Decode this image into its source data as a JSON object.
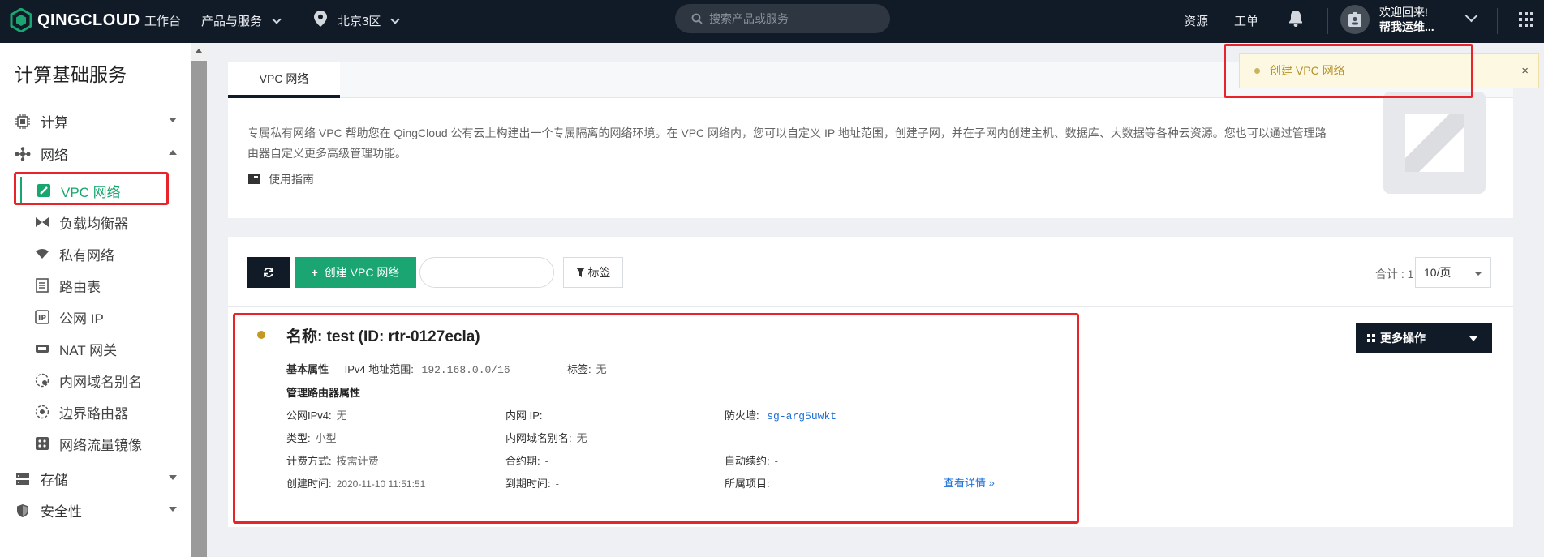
{
  "topbar": {
    "brand": "QINGCLOUD",
    "nav": {
      "workbench": "工作台",
      "products": "产品与服务",
      "region": "北京3区"
    },
    "search_placeholder": "搜索产品或服务",
    "resources": "资源",
    "tickets": "工单",
    "welcome": "欢迎回来!",
    "user": "帮我运维..."
  },
  "sidebar": {
    "title": "计算基础服务",
    "groups": {
      "compute": "计算",
      "network": "网络",
      "storage": "存储",
      "security": "安全性"
    },
    "items": [
      {
        "label": "VPC 网络"
      },
      {
        "label": "负载均衡器"
      },
      {
        "label": "私有网络"
      },
      {
        "label": "路由表"
      },
      {
        "label": "公网 IP"
      },
      {
        "label": "NAT 网关"
      },
      {
        "label": "内网域名别名"
      },
      {
        "label": "边界路由器"
      },
      {
        "label": "网络流量镜像"
      }
    ]
  },
  "intro": {
    "tab": "VPC 网络",
    "description": "专属私有网络 VPC 帮助您在 QingCloud 公有云上构建出一个专属隔离的网络环境。在 VPC 网络内，您可以自定义 IP 地址范围，创建子网，并在子网内创建主机、数据库、大数据等各种云资源。您也可以通过管理路由器自定义更多高级管理功能。",
    "guide": "使用指南"
  },
  "toolbar": {
    "create": "创建 VPC 网络",
    "tag": "标签",
    "total": "合计 : 1",
    "page_size": "10/页"
  },
  "resource": {
    "title": "名称: test (ID: rtr-0127ecla)",
    "basic_label": "基本属性",
    "ipv4_range_label": "IPv4 地址范围:",
    "ipv4_range": "192.168.0.0/16",
    "tags_label": "标签:",
    "tags": "无",
    "router_section": "管理路由器属性",
    "public_ipv4_label": "公网IPv4:",
    "public_ipv4": "无",
    "private_ip_label": "内网 IP:",
    "private_ip": "",
    "firewall_label": "防火墙:",
    "firewall": "sg-arg5uwkt",
    "type_label": "类型:",
    "type": "小型",
    "dns_alias_label": "内网域名别名:",
    "dns_alias": "无",
    "billing_label": "计费方式:",
    "billing": "按需计费",
    "contract_label": "合约期:",
    "contract": "-",
    "auto_renew_label": "自动续约:",
    "auto_renew": "-",
    "created_label": "创建时间:",
    "created": "2020-11-10 11:51:51",
    "expire_label": "到期时间:",
    "expire": "-",
    "project_label": "所属项目:",
    "project": "",
    "details": "查看详情 »",
    "more_ops": "更多操作",
    "status_color": "#c29a22"
  },
  "toast": {
    "text": "创建 VPC 网络",
    "close": "×"
  },
  "colors": {
    "topbar": "#111b27",
    "accent_green": "#1aa572",
    "highlight_red": "#e8232a",
    "link_blue": "#1d6fd8"
  }
}
